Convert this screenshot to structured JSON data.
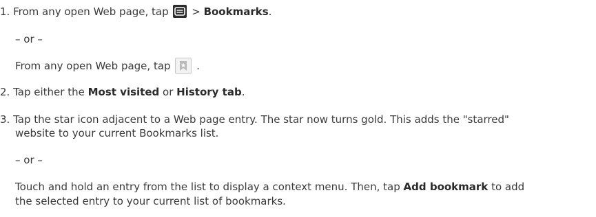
{
  "steps": [
    {
      "number": "1.",
      "text_before": "From any open Web page, tap",
      "menu_icon": "menu-key-icon",
      "separator": ">",
      "target": "Bookmarks",
      "end": ".",
      "or": "– or –",
      "alt_before": "From any open Web page, tap",
      "bookmark_icon": "bookmark-tab-icon",
      "alt_end": "."
    },
    {
      "number": "2.",
      "text_before": "Tap either the",
      "tab1": "Most visited",
      "mid": "or",
      "tab2": "History tab",
      "end": "."
    },
    {
      "number": "3.",
      "line1": "Tap the star icon adjacent to a Web page entry. The star now turns gold. This adds the \"starred\"",
      "line2": "website to your current Bookmarks list.",
      "or": "– or –",
      "alt_line1_before": "Touch and hold an entry from the list to display a context menu. Then, tap",
      "alt_target": "Add bookmark",
      "alt_line1_after": "to add",
      "alt_line2": "the selected entry to your current list of bookmarks."
    }
  ]
}
